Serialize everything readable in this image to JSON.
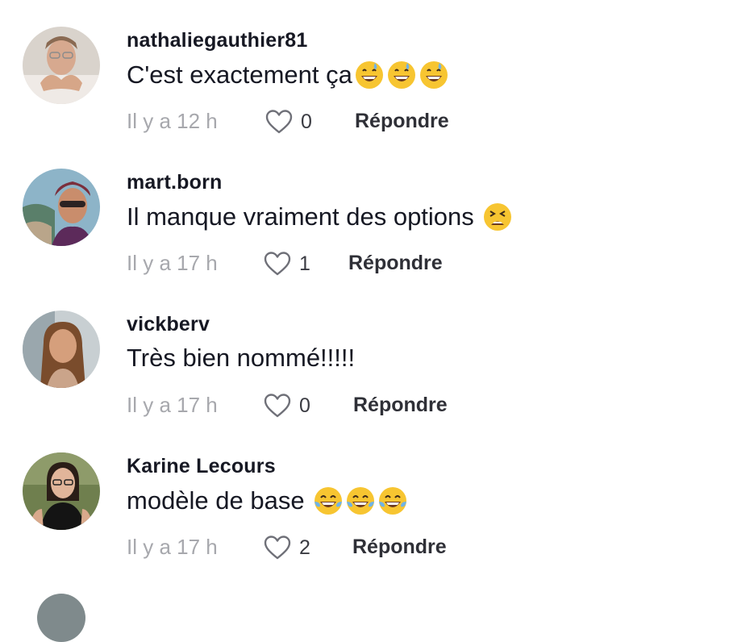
{
  "comments": [
    {
      "username": "nathaliegauthier81",
      "text": "C'est exactement ça",
      "emojis": [
        "grinning-sweat-emoji",
        "grinning-sweat-emoji",
        "grinning-sweat-emoji"
      ],
      "time": "Il y a 12 h",
      "likes": "0",
      "reply": "Répondre"
    },
    {
      "username": "mart.born",
      "text": "Il manque vraiment des options ",
      "emojis": [
        "tired-face-emoji"
      ],
      "time": "Il y a 17 h",
      "likes": "1",
      "reply": "Répondre"
    },
    {
      "username": "vickberv",
      "text": "Très bien nommé!!!!!",
      "emojis": [],
      "time": "Il y a 17 h",
      "likes": "0",
      "reply": "Répondre"
    },
    {
      "username": "Karine Lecours",
      "text": "modèle de base ",
      "emojis": [
        "tears-of-joy-emoji",
        "tears-of-joy-emoji",
        "tears-of-joy-emoji"
      ],
      "time": "Il y a 17 h",
      "likes": "2",
      "reply": "Répondre"
    }
  ],
  "colors": {
    "username": "#161823",
    "meta": "#a7a8ad",
    "reply": "#2f3037",
    "emoji_yellow": "#f7c531"
  }
}
